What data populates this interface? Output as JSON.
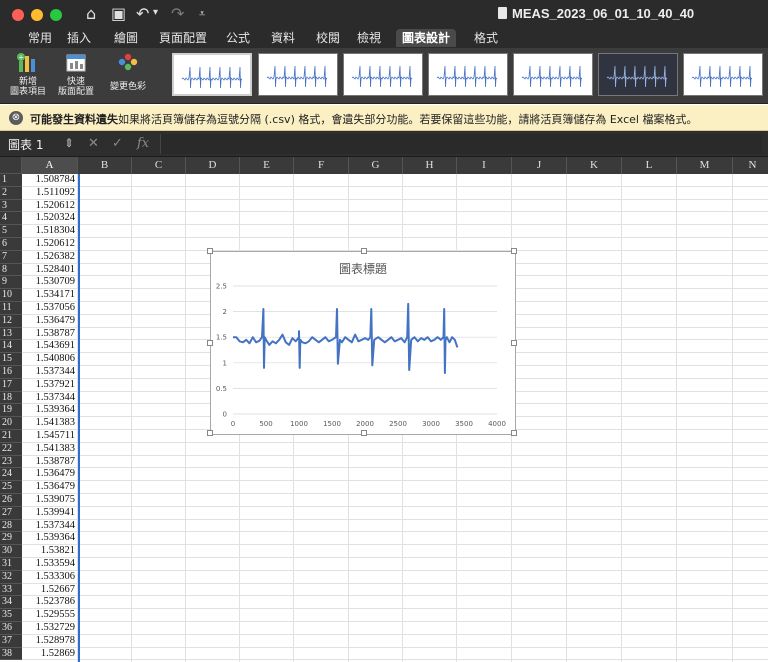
{
  "window": {
    "title": "MEAS_2023_06_01_10_40_40",
    "traffic_colors": [
      "#ff5f57",
      "#febc2e",
      "#28c840"
    ]
  },
  "quick_access": {
    "icons": [
      "home-icon",
      "save-icon",
      "undo-icon",
      "redo-icon",
      "customize-icon"
    ],
    "glyphs": {
      "home": "⌂",
      "save": "▣",
      "undo": "↶",
      "undo_dd": "▾",
      "redo": "↷",
      "customize": "⩡"
    }
  },
  "ribbon_tabs": [
    {
      "label": "常用"
    },
    {
      "label": "插入"
    },
    {
      "label": "繪圖"
    },
    {
      "label": "頁面配置"
    },
    {
      "label": "公式"
    },
    {
      "label": "資料"
    },
    {
      "label": "校閱"
    },
    {
      "label": "檢視"
    },
    {
      "label": "圖表設計",
      "active": true
    },
    {
      "label": "格式"
    }
  ],
  "ribbon": {
    "add_chart_element": [
      "新增",
      "圖表項目"
    ],
    "quick_layout": [
      "快速",
      "版面配置"
    ],
    "change_colors": "變更色彩",
    "chart_styles": [
      "style-1",
      "style-2",
      "style-3",
      "style-4",
      "style-5",
      "style-6",
      "style-7"
    ]
  },
  "message_bar": {
    "icon": "⊗",
    "title": "可能發生資料遺失",
    "text": "如果將活頁簿儲存為逗號分隔 (.csv) 格式，會遺失部分功能。若要保留這些功能，請將活頁簿儲存為 Excel 檔案格式。"
  },
  "formula_bar": {
    "name_box": "圖表 1",
    "stepper": "⇕",
    "cancel_glyph": "✕",
    "confirm_glyph": "✓",
    "fx_glyph": "fx",
    "value": ""
  },
  "columns": [
    "A",
    "B",
    "C",
    "D",
    "E",
    "F",
    "G",
    "H",
    "I",
    "J",
    "K",
    "L",
    "M",
    "N"
  ],
  "rows": [
    {
      "n": "1",
      "a": "1.508784"
    },
    {
      "n": "2",
      "a": "1.511092"
    },
    {
      "n": "3",
      "a": "1.520612"
    },
    {
      "n": "4",
      "a": "1.520324"
    },
    {
      "n": "5",
      "a": "1.518304"
    },
    {
      "n": "6",
      "a": "1.520612"
    },
    {
      "n": "7",
      "a": "1.526382"
    },
    {
      "n": "8",
      "a": "1.528401"
    },
    {
      "n": "9",
      "a": "1.530709"
    },
    {
      "n": "10",
      "a": "1.534171"
    },
    {
      "n": "11",
      "a": "1.537056"
    },
    {
      "n": "12",
      "a": "1.536479"
    },
    {
      "n": "13",
      "a": "1.538787"
    },
    {
      "n": "14",
      "a": "1.543691"
    },
    {
      "n": "15",
      "a": "1.540806"
    },
    {
      "n": "16",
      "a": "1.537344"
    },
    {
      "n": "17",
      "a": "1.537921"
    },
    {
      "n": "18",
      "a": "1.537344"
    },
    {
      "n": "19",
      "a": "1.539364"
    },
    {
      "n": "20",
      "a": "1.541383"
    },
    {
      "n": "21",
      "a": "1.545711"
    },
    {
      "n": "22",
      "a": "1.541383"
    },
    {
      "n": "23",
      "a": "1.538787"
    },
    {
      "n": "24",
      "a": "1.536479"
    },
    {
      "n": "25",
      "a": "1.536479"
    },
    {
      "n": "26",
      "a": "1.539075"
    },
    {
      "n": "27",
      "a": "1.539941"
    },
    {
      "n": "28",
      "a": "1.537344"
    },
    {
      "n": "29",
      "a": "1.539364"
    },
    {
      "n": "30",
      "a": "1.53821"
    },
    {
      "n": "31",
      "a": "1.533594"
    },
    {
      "n": "32",
      "a": "1.533306"
    },
    {
      "n": "33",
      "a": "1.52667"
    },
    {
      "n": "34",
      "a": "1.523786"
    },
    {
      "n": "35",
      "a": "1.529555"
    },
    {
      "n": "36",
      "a": "1.532729"
    },
    {
      "n": "37",
      "a": "1.528978"
    },
    {
      "n": "38",
      "a": "1.52869"
    }
  ],
  "chart_data": {
    "type": "line",
    "title": "圖表標題",
    "xlim": [
      0,
      4000
    ],
    "ylim": [
      0,
      2.5
    ],
    "x_ticks": [
      "0",
      "500",
      "1000",
      "1500",
      "2000",
      "2500",
      "3000",
      "3500",
      "4000"
    ],
    "y_ticks": [
      "0",
      "0.5",
      "1",
      "1.5",
      "2",
      "2.5"
    ],
    "grid": true,
    "legend": false,
    "line_color": "#4472c4",
    "series": [
      {
        "x": [
          0,
          50,
          100,
          150,
          200,
          250,
          300,
          350,
          400,
          440,
          460,
          470,
          480,
          500,
          550,
          600,
          650,
          700,
          750,
          800,
          850,
          900,
          950,
          1000,
          1000,
          1010,
          1020,
          1050,
          1100,
          1150,
          1200,
          1250,
          1300,
          1350,
          1400,
          1450,
          1500,
          1560,
          1575,
          1590,
          1620,
          1650,
          1700,
          1750,
          1800,
          1850,
          1900,
          1950,
          2000,
          2050,
          2080,
          2095,
          2110,
          2140,
          2200,
          2250,
          2300,
          2350,
          2400,
          2450,
          2500,
          2550,
          2600,
          2640,
          2655,
          2670,
          2700,
          2750,
          2800,
          2850,
          2900,
          2950,
          3000,
          3050,
          3100,
          3150,
          3190,
          3200,
          3210,
          3220,
          3240,
          3280,
          3320,
          3360,
          3400
        ],
        "y": [
          1.5,
          1.5,
          1.42,
          1.4,
          1.45,
          1.38,
          1.5,
          1.4,
          1.43,
          1.5,
          2.05,
          0.9,
          1.5,
          1.45,
          1.35,
          1.42,
          1.38,
          1.45,
          1.55,
          1.4,
          1.35,
          1.48,
          1.42,
          1.5,
          1.62,
          0.9,
          1.45,
          1.4,
          1.38,
          1.42,
          1.5,
          1.45,
          1.4,
          1.45,
          1.5,
          1.42,
          1.45,
          1.5,
          2.05,
          0.98,
          1.45,
          1.4,
          1.5,
          1.45,
          1.4,
          1.55,
          1.42,
          1.45,
          1.48,
          1.45,
          1.5,
          2.05,
          0.95,
          1.45,
          1.5,
          1.45,
          1.4,
          1.45,
          1.5,
          1.42,
          1.45,
          1.48,
          1.4,
          1.5,
          2.15,
          0.86,
          1.45,
          1.5,
          1.42,
          1.48,
          1.45,
          1.5,
          1.42,
          1.45,
          1.5,
          1.45,
          1.5,
          2.05,
          0.8,
          1.45,
          1.5,
          1.4,
          1.5,
          1.45,
          1.3
        ]
      }
    ]
  }
}
